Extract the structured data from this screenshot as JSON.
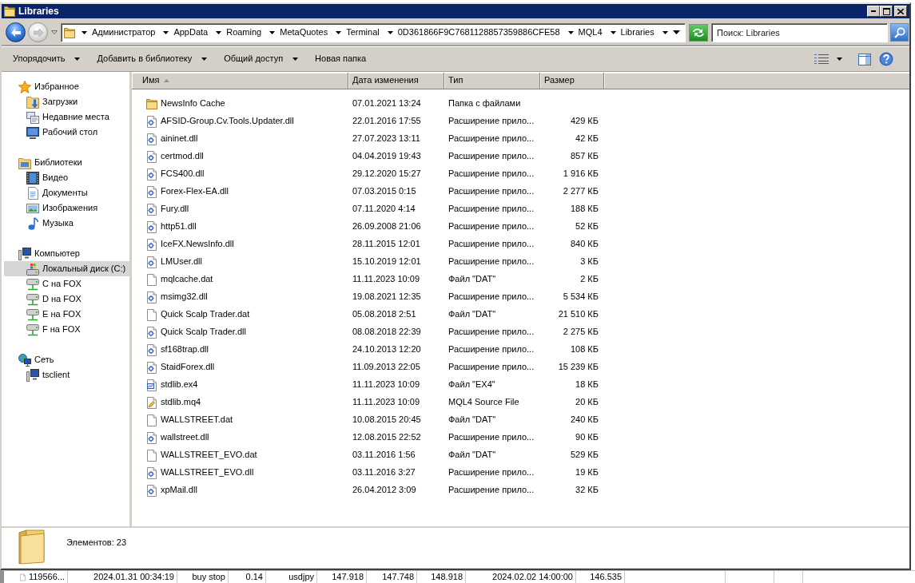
{
  "window": {
    "title": "Libraries"
  },
  "navigation": {
    "back": {
      "disabled": false
    },
    "forward": {
      "disabled": true
    }
  },
  "address_bar": {
    "path": [
      "Администратор",
      "AppData",
      "Roaming",
      "MetaQuotes",
      "Terminal",
      "0D361866F9C7681128857359886CFE58",
      "MQL4",
      "Libraries"
    ]
  },
  "search": {
    "placeholder": "Поиск: Libraries"
  },
  "toolbar": {
    "items": [
      {
        "label": "Упорядочить",
        "dropdown": true
      },
      {
        "label": "Добавить в библиотеку",
        "dropdown": true
      },
      {
        "label": "Общий доступ",
        "dropdown": true
      },
      {
        "label": "Новая папка",
        "dropdown": false
      }
    ]
  },
  "sidebar": {
    "groups": [
      {
        "label": "Избранное",
        "kind": "favorites",
        "selected": false,
        "children": [
          {
            "label": "Загрузки",
            "kind": "downloads",
            "selected": false
          },
          {
            "label": "Недавние места",
            "kind": "recent",
            "selected": false
          },
          {
            "label": "Рабочий стол",
            "kind": "desktop",
            "selected": false
          }
        ]
      },
      {
        "label": "Библиотеки",
        "kind": "libraries",
        "selected": false,
        "children": [
          {
            "label": "Видео",
            "kind": "video",
            "selected": false
          },
          {
            "label": "Документы",
            "kind": "documents",
            "selected": false
          },
          {
            "label": "Изображения",
            "kind": "pictures",
            "selected": false
          },
          {
            "label": "Музыка",
            "kind": "music",
            "selected": false
          }
        ]
      },
      {
        "label": "Компьютер",
        "kind": "computer",
        "selected": false,
        "children": [
          {
            "label": "Локальный диск (C:)",
            "kind": "disk",
            "selected": true
          },
          {
            "label": "C на FOX",
            "kind": "netdrive",
            "selected": false
          },
          {
            "label": "D на FOX",
            "kind": "netdrive",
            "selected": false
          },
          {
            "label": "E на FOX",
            "kind": "netdrive",
            "selected": false
          },
          {
            "label": "F на FOX",
            "kind": "netdrive",
            "selected": false
          }
        ]
      },
      {
        "label": "Сеть",
        "kind": "network",
        "selected": false,
        "children": [
          {
            "label": "tsclient",
            "kind": "computer",
            "selected": false
          }
        ]
      }
    ]
  },
  "table": {
    "columns": [
      {
        "label": "Имя",
        "sorted": true
      },
      {
        "label": "Дата изменения",
        "sorted": false
      },
      {
        "label": "Тип",
        "sorted": false
      },
      {
        "label": "Размер",
        "sorted": false
      }
    ],
    "rows": [
      {
        "kind": "folder",
        "name": "NewsInfo Cache",
        "date": "07.01.2021 13:24",
        "type": "Папка с файлами",
        "selected": false
      },
      {
        "kind": "dll",
        "name": "AFSID-Group.Cv.Tools.Updater.dll",
        "date": "22.01.2016 17:55",
        "type": "Расширение прило...",
        "size": "429 КБ",
        "selected": false
      },
      {
        "kind": "dll",
        "name": "aininet.dll",
        "date": "27.07.2023 13:11",
        "type": "Расширение прило...",
        "size": "42 КБ",
        "selected": false
      },
      {
        "kind": "dll",
        "name": "certmod.dll",
        "date": "04.04.2019 19:43",
        "type": "Расширение прило...",
        "size": "857 КБ",
        "selected": false
      },
      {
        "kind": "dll",
        "name": "FCS400.dll",
        "date": "29.12.2020 15:27",
        "type": "Расширение прило...",
        "size": "1 916 КБ",
        "selected": false
      },
      {
        "kind": "dll",
        "name": "Forex-Flex-EA.dll",
        "date": "07.03.2015 0:15",
        "type": "Расширение прило...",
        "size": "2 277 КБ",
        "selected": false
      },
      {
        "kind": "dll",
        "name": "Fury.dll",
        "date": "07.11.2020 4:14",
        "type": "Расширение прило...",
        "size": "188 КБ",
        "selected": false
      },
      {
        "kind": "dll",
        "name": "http51.dll",
        "date": "26.09.2008 21:06",
        "type": "Расширение прило...",
        "size": "52 КБ",
        "selected": false
      },
      {
        "kind": "dll",
        "name": "IceFX.NewsInfo.dll",
        "date": "28.11.2015 12:01",
        "type": "Расширение прило...",
        "size": "840 КБ",
        "selected": false
      },
      {
        "kind": "dll",
        "name": "LMUser.dll",
        "date": "15.10.2019 12:01",
        "type": "Расширение прило...",
        "size": "3 КБ",
        "selected": false
      },
      {
        "kind": "dat",
        "name": "mqlcache.dat",
        "date": "11.11.2023 10:09",
        "type": "Файл \"DAT\"",
        "size": "2 КБ",
        "selected": false
      },
      {
        "kind": "dll",
        "name": "msimg32.dll",
        "date": "19.08.2021 12:35",
        "type": "Расширение прило...",
        "size": "5 534 КБ",
        "selected": false
      },
      {
        "kind": "dat",
        "name": "Quick Scalp Trader.dat",
        "date": "05.08.2018 2:51",
        "type": "Файл \"DAT\"",
        "size": "21 510 КБ",
        "selected": false
      },
      {
        "kind": "dll",
        "name": "Quick Scalp Trader.dll",
        "date": "08.08.2018 22:39",
        "type": "Расширение прило...",
        "size": "2 275 КБ",
        "selected": false
      },
      {
        "kind": "dll",
        "name": "sf168trap.dll",
        "date": "24.10.2013 12:20",
        "type": "Расширение прило...",
        "size": "108 КБ",
        "selected": false
      },
      {
        "kind": "dll",
        "name": "StaidForex.dll",
        "date": "11.09.2013 22:05",
        "type": "Расширение прило...",
        "size": "15 239 КБ",
        "selected": false
      },
      {
        "kind": "ex4",
        "name": "stdlib.ex4",
        "date": "11.11.2023 10:09",
        "type": "Файл \"EX4\"",
        "size": "18 КБ",
        "selected": false
      },
      {
        "kind": "mq4",
        "name": "stdlib.mq4",
        "date": "11.11.2023 10:09",
        "type": "MQL4 Source File",
        "size": "20 КБ",
        "selected": false
      },
      {
        "kind": "dat",
        "name": "WALLSTREET.dat",
        "date": "10.08.2015 20:45",
        "type": "Файл \"DAT\"",
        "size": "240 КБ",
        "selected": false
      },
      {
        "kind": "dll",
        "name": "wallstreet.dll",
        "date": "12.08.2015 22:52",
        "type": "Расширение прило...",
        "size": "90 КБ",
        "selected": false
      },
      {
        "kind": "dat",
        "name": "WALLSTREET_EVO.dat",
        "date": "03.11.2016 1:56",
        "type": "Файл \"DAT\"",
        "size": "529 КБ",
        "selected": false
      },
      {
        "kind": "dll",
        "name": "WALLSTREET_EVO.dll",
        "date": "03.11.2016 3:27",
        "type": "Расширение прило...",
        "size": "19 КБ",
        "selected": false
      },
      {
        "kind": "dll",
        "name": "xpMail.dll",
        "date": "26.04.2012 3:09",
        "type": "Расширение прило...",
        "size": "32 КБ",
        "selected": false
      }
    ]
  },
  "details_pane": {
    "text": "Элементов: 23"
  },
  "background_window": {
    "row": [
      "119566...",
      "2024.01.31 00:34:19",
      "buy stop",
      "0.14",
      "usdjpy",
      "147.918",
      "147.748",
      "148.918",
      "2024.02.02 14:00:00",
      "146.535"
    ]
  }
}
